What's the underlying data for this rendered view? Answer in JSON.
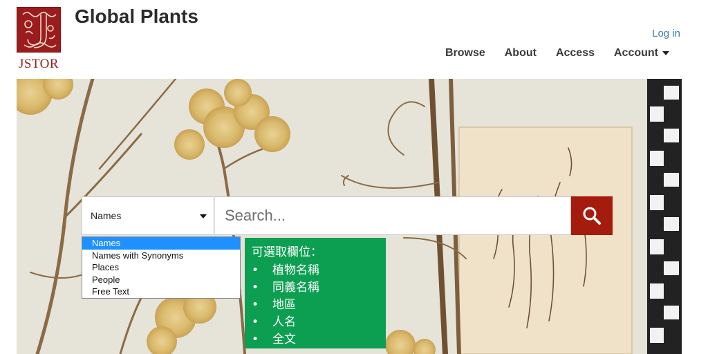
{
  "header": {
    "logo_text": "JSTOR",
    "site_title": "Global Plants",
    "login_label": "Log in",
    "nav": [
      {
        "label": "Browse"
      },
      {
        "label": "About"
      },
      {
        "label": "Access"
      },
      {
        "label": "Account",
        "has_dropdown": true
      }
    ]
  },
  "search": {
    "field_selected": "Names",
    "placeholder": "Search...",
    "button_icon": "search-icon",
    "options": [
      "Names",
      "Names with Synonyms",
      "Places",
      "People",
      "Free Text"
    ],
    "active_option": "Names"
  },
  "annotation": {
    "title": "可選取欄位：",
    "items": [
      "植物名稱",
      "同義名稱",
      "地區",
      "人名",
      "全文"
    ]
  },
  "colors": {
    "brand_red": "#9b1c1c",
    "search_button": "#a51c0e",
    "link_blue": "#3f7ab6",
    "annotation_green": "#0c9f52",
    "highlight_blue": "#1e90ff"
  }
}
